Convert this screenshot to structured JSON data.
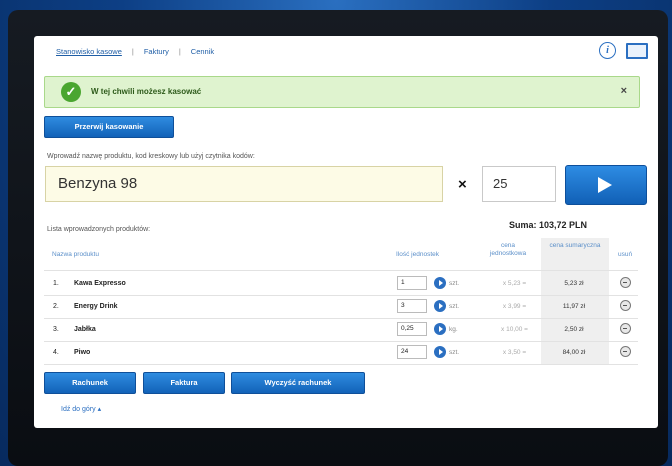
{
  "nav": {
    "items": [
      "Stanowisko kasowe",
      "Faktury",
      "Cennik"
    ],
    "separators": [
      "|",
      "|"
    ]
  },
  "icons": {
    "info": "info-icon",
    "monitor": "monitor-icon"
  },
  "alert": {
    "text": "W tej chwili możesz kasować",
    "check_glyph": "✓",
    "close_glyph": "×",
    "color": "#dff3cf"
  },
  "buttons": {
    "reset": "Przerwij kasowanie",
    "receipt": "Rachunek",
    "invoice": "Faktura",
    "clear": "Wyczyść rachunek"
  },
  "entry": {
    "instruction": "Wprowadź nazwę produktu, kod kreskowy lub użyj czytnika kodów:",
    "product_value": "Benzyna 98",
    "times": "×",
    "quantity_value": "25"
  },
  "list": {
    "title": "Lista wprowadzonych produktów:",
    "sum_label": "Suma: 103,72 PLN",
    "headers": {
      "name": "Nazwa produktu",
      "qty": "Ilość jednostek",
      "unit_price": "cena jednostkowa",
      "total_price": "cena sumaryczna",
      "delete": "usuń"
    },
    "rows": [
      {
        "num": "1.",
        "name": "Kawa Expresso",
        "qty": "1",
        "unit": "szt.",
        "unit_price": "x 5,23 =",
        "total": "5,23 zł"
      },
      {
        "num": "2.",
        "name": "Energy Drink",
        "qty": "3",
        "unit": "szt.",
        "unit_price": "x 3,99 =",
        "total": "11,97 zł"
      },
      {
        "num": "3.",
        "name": "Jabłka",
        "qty": "0,25",
        "unit": "kg.",
        "unit_price": "x 10,00 =",
        "total": "2,50 zł"
      },
      {
        "num": "4.",
        "name": "Piwo",
        "qty": "24",
        "unit": "szt.",
        "unit_price": "x 3,50 =",
        "total": "84,00 zł"
      }
    ]
  },
  "footer": {
    "back_link": "Idź do góry ▴"
  }
}
